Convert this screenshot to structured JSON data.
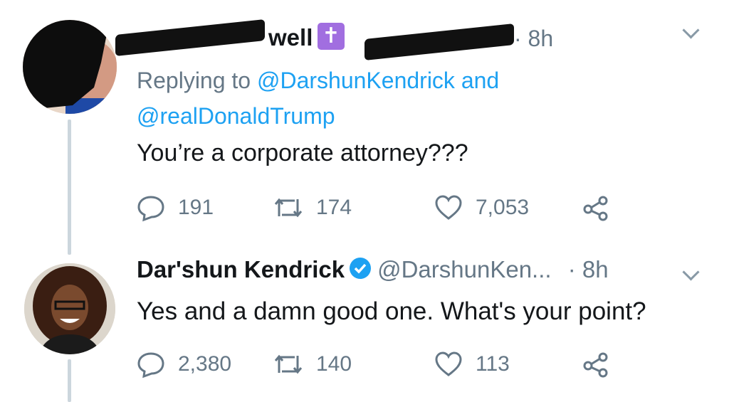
{
  "tweet1": {
    "name_fragment": "well",
    "badge_symbol": "✝",
    "time": "· 8h",
    "replying_prefix": "Replying to",
    "mention1": "@DarshunKendrick",
    "joiner": "and",
    "mention2": "@realDonaldTrump",
    "text": "You’re a corporate attorney???",
    "replies": "191",
    "retweets": "174",
    "likes": "7,053"
  },
  "tweet2": {
    "name": "Dar'shun Kendrick",
    "handle": "@DarshunKen...",
    "time": "· 8h",
    "text": "Yes and a damn good one. What's your point?",
    "replies": "2,380",
    "retweets": "140",
    "likes": "113"
  },
  "colors": {
    "link": "#1da1f2",
    "muted": "#657786",
    "badge": "#a16ee0"
  }
}
